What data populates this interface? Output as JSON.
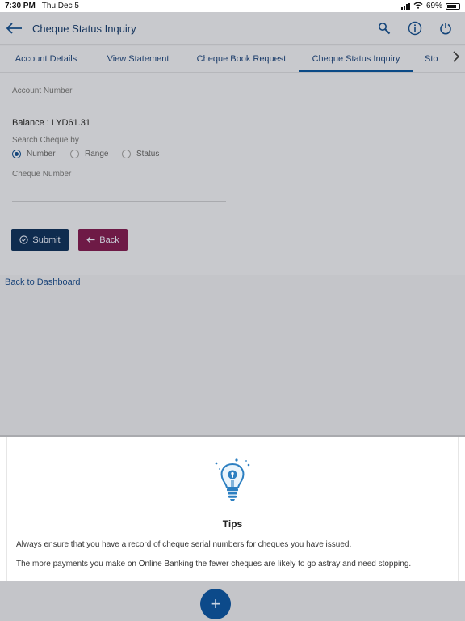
{
  "status_bar": {
    "time": "7:30 PM",
    "date": "Thu Dec 5",
    "battery": "69%"
  },
  "header": {
    "title": "Cheque Status Inquiry"
  },
  "tabs": [
    {
      "label": "Account Details"
    },
    {
      "label": "View Statement"
    },
    {
      "label": "Cheque Book Request"
    },
    {
      "label": "Cheque Status Inquiry",
      "active": true
    },
    {
      "label": "Sto"
    }
  ],
  "form": {
    "account_number_label": "Account Number",
    "balance": "Balance : LYD61.31",
    "search_by_label": "Search Cheque by",
    "options": [
      "Number",
      "Range",
      "Status"
    ],
    "selected_option": "Number",
    "cheque_number_label": "Cheque Number",
    "submit_label": "Submit",
    "back_label": "Back"
  },
  "dashboard_link": "Back to Dashboard",
  "tips": {
    "title": "Tips",
    "items": [
      "Always ensure that you have a record of cheque serial numbers for cheques you have issued.",
      "The more payments you make on Online Banking the fewer cheques are likely to go astray and need stopping."
    ]
  },
  "fab": {
    "label": "+"
  },
  "colors": {
    "primary": "#0f2c4f",
    "accent": "#6e1a46",
    "link": "#1a4479",
    "tab_active": "#0b4a86"
  }
}
